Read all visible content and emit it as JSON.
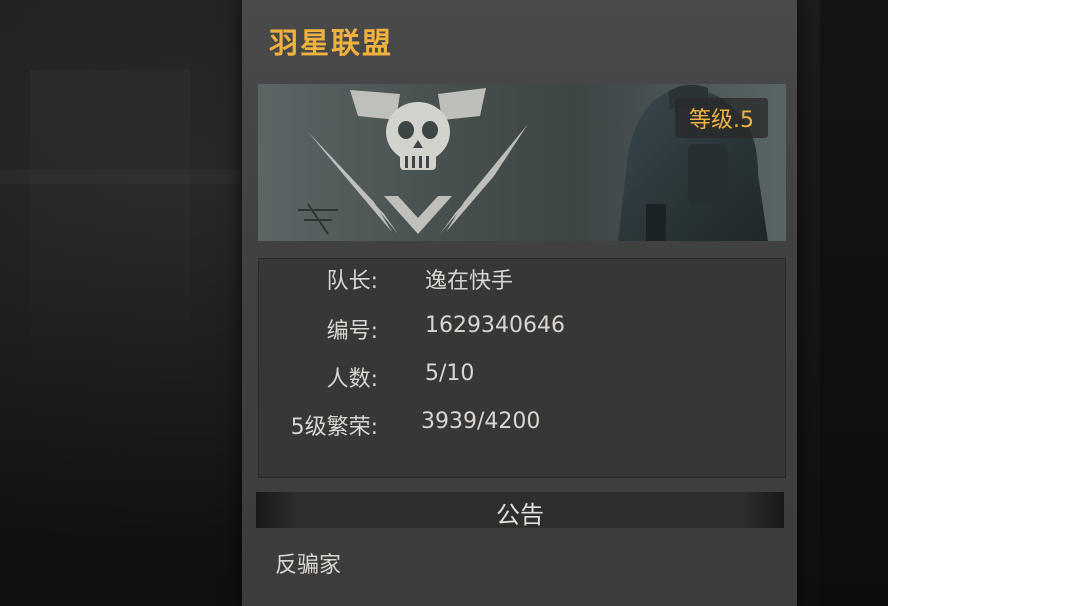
{
  "guild": {
    "name": "羽星联盟",
    "level_badge": "等级.5"
  },
  "info": {
    "rows": [
      {
        "label": "队长:",
        "value": "逸在快手"
      },
      {
        "label": "编号:",
        "value": "1629340646"
      },
      {
        "label": "人数:",
        "value": "5/10"
      },
      {
        "label": "5级繁荣:",
        "value": "3939/4200"
      }
    ]
  },
  "notice": {
    "header": "公告",
    "text": "反骗家"
  },
  "icons": {
    "emblem": "skull-emblem-icon"
  },
  "colors": {
    "accent": "#f0b23f",
    "text": "#d9d5d0",
    "panel": "#444444"
  }
}
